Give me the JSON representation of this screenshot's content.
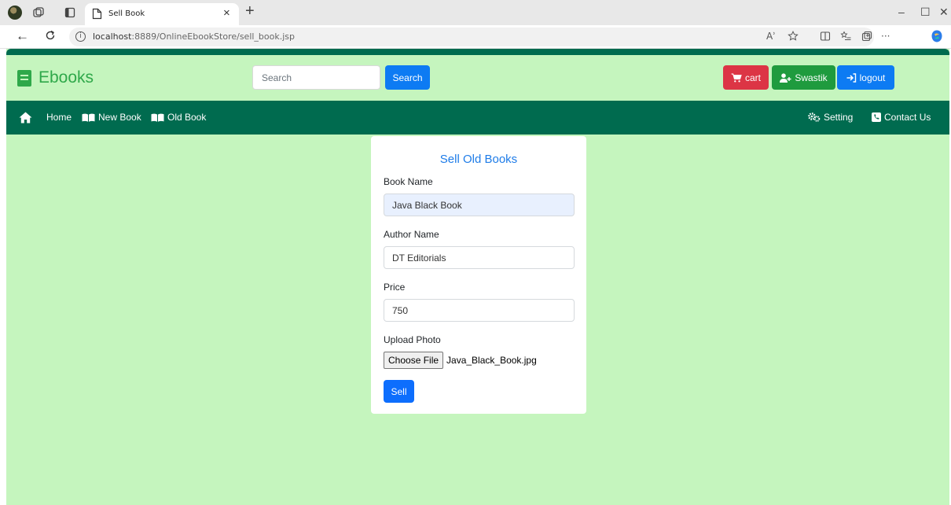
{
  "browser": {
    "tab_title": "Sell Book",
    "tab_close": "×",
    "new_tab": "+",
    "url_host": "localhost",
    "url_path": ":8889/OnlineEbookStore/sell_book.jsp",
    "info_icon": "i",
    "read_aloud": "Aʾ",
    "window": {
      "minimize": "–",
      "maximize": "☐",
      "close": "✕"
    },
    "more": "···"
  },
  "header": {
    "brand": "Ebooks",
    "search_placeholder": "Search",
    "search_button": "Search",
    "cart_label": "cart",
    "user_label": "Swastik",
    "logout_label": "logout"
  },
  "navbar": {
    "home": "Home",
    "new_book": "New Book",
    "old_book": "Old Book",
    "setting": "Setting",
    "contact": "Contact Us"
  },
  "form": {
    "title": "Sell Old Books",
    "book_name_label": "Book Name",
    "book_name_value": "Java Black Book",
    "author_label": "Author Name",
    "author_value": "DT Editorials",
    "price_label": "Price",
    "price_value": "750",
    "upload_label": "Upload Photo",
    "choose_file": "Choose File",
    "file_name": "Java_Black_Book.jpg",
    "sell_button": "Sell"
  },
  "colors": {
    "page_bg": "#c5f5be",
    "nav_bg": "#006b4f",
    "brand": "#2fa84a",
    "primary": "#0d7bf3",
    "danger": "#dc3545",
    "success": "#1f9b3e",
    "title": "#1e7ce8"
  }
}
